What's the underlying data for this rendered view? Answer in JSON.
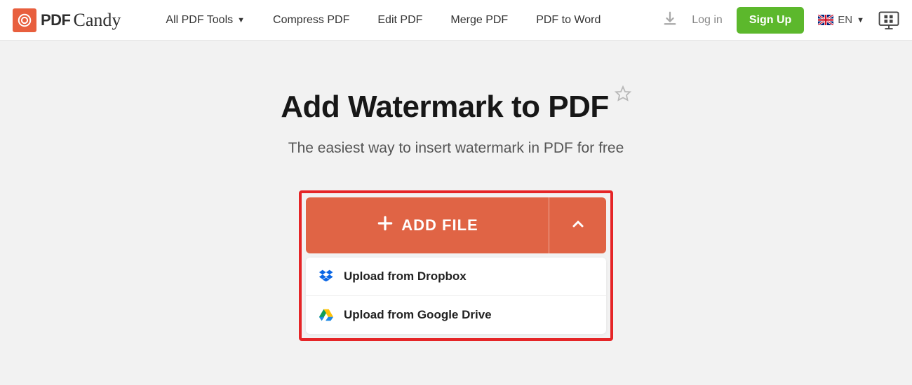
{
  "logo": {
    "pdf": "PDF",
    "candy": "Candy"
  },
  "nav": {
    "all_tools": "All PDF Tools",
    "compress": "Compress PDF",
    "edit": "Edit PDF",
    "merge": "Merge PDF",
    "to_word": "PDF to Word"
  },
  "header": {
    "login": "Log in",
    "signup": "Sign Up",
    "lang": "EN"
  },
  "page": {
    "title": "Add Watermark to PDF",
    "subtitle": "The easiest way to insert watermark in PDF for free"
  },
  "upload": {
    "add_file": "ADD FILE",
    "dropbox": "Upload from Dropbox",
    "gdrive": "Upload from Google Drive"
  }
}
